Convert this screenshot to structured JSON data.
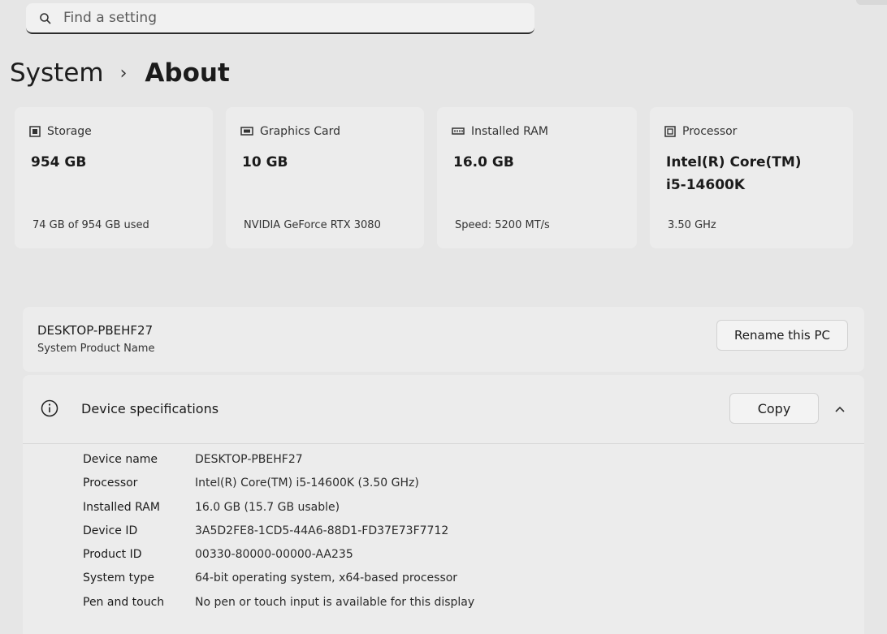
{
  "search": {
    "placeholder": "Find a setting"
  },
  "breadcrumb": {
    "parent": "System",
    "separator": "›",
    "current": "About"
  },
  "cards": [
    {
      "icon": "storage-icon",
      "label": "Storage",
      "value": "954 GB",
      "sub": "74 GB of 954 GB used"
    },
    {
      "icon": "graphics-card-icon",
      "label": "Graphics Card",
      "value": "10 GB",
      "sub": "NVIDIA GeForce RTX 3080"
    },
    {
      "icon": "ram-icon",
      "label": "Installed RAM",
      "value": "16.0 GB",
      "sub": "Speed: 5200 MT/s"
    },
    {
      "icon": "processor-icon",
      "label": "Processor",
      "value_line1": "Intel(R) Core(TM)",
      "value_line2": "i5-14600K",
      "sub": "3.50 GHz"
    }
  ],
  "pc": {
    "name": "DESKTOP-PBEHF27",
    "subtitle": "System Product Name",
    "rename_label": "Rename this PC"
  },
  "specs": {
    "title": "Device specifications",
    "copy_label": "Copy",
    "rows": [
      {
        "key": "Device name",
        "value": "DESKTOP-PBEHF27"
      },
      {
        "key": "Processor",
        "value": "Intel(R) Core(TM) i5-14600K (3.50 GHz)"
      },
      {
        "key": "Installed RAM",
        "value": "16.0 GB (15.7 GB usable)"
      },
      {
        "key": "Device ID",
        "value": "3A5D2FE8-1CD5-44A6-88D1-FD37E73F7712"
      },
      {
        "key": "Product ID",
        "value": "00330-80000-00000-AA235"
      },
      {
        "key": "System type",
        "value": "64-bit operating system, x64-based processor"
      },
      {
        "key": "Pen and touch",
        "value": "No pen or touch input is available for this display"
      }
    ]
  }
}
